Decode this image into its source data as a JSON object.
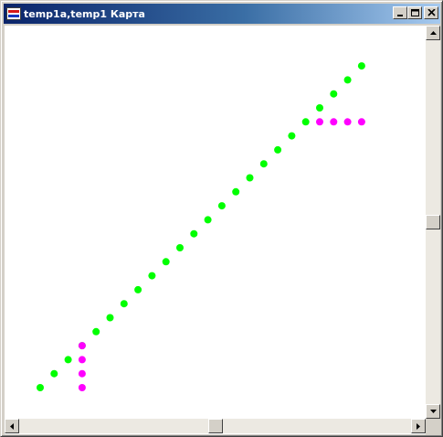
{
  "window": {
    "title": "temp1a,temp1 Карта",
    "icon": "map-window-icon",
    "caption_buttons": [
      "minimize-icon",
      "maximize-icon",
      "close-icon"
    ]
  },
  "colors": {
    "title_active_start": "#0a246a",
    "title_active_end": "#a6caf0",
    "series_temp1a": "#00ff00",
    "series_temp1": "#ff00ff"
  },
  "map": {
    "layers": [
      {
        "name": "temp1a",
        "color": "#00ff00",
        "points": [
          [
            0,
            0
          ],
          [
            1,
            1
          ],
          [
            2,
            2
          ],
          [
            3,
            3
          ],
          [
            4,
            4
          ],
          [
            5,
            5
          ],
          [
            6,
            6
          ],
          [
            7,
            7
          ],
          [
            8,
            8
          ],
          [
            9,
            9
          ],
          [
            10,
            10
          ],
          [
            11,
            11
          ],
          [
            12,
            12
          ],
          [
            13,
            13
          ],
          [
            14,
            14
          ],
          [
            15,
            15
          ],
          [
            16,
            16
          ],
          [
            17,
            17
          ],
          [
            18,
            18
          ],
          [
            19,
            19
          ],
          [
            20,
            20
          ],
          [
            21,
            21
          ],
          [
            22,
            22
          ],
          [
            23,
            23
          ]
        ]
      },
      {
        "name": "temp1",
        "color": "#ff00ff",
        "points": [
          [
            3,
            0
          ],
          [
            3,
            1
          ],
          [
            3,
            2
          ],
          [
            3,
            3
          ],
          [
            20,
            19
          ],
          [
            21,
            19
          ],
          [
            22,
            19
          ],
          [
            23,
            19
          ]
        ]
      }
    ]
  },
  "scrollbars": {
    "vertical": {
      "position": 0.5
    },
    "horizontal": {
      "position": 0.5
    }
  }
}
